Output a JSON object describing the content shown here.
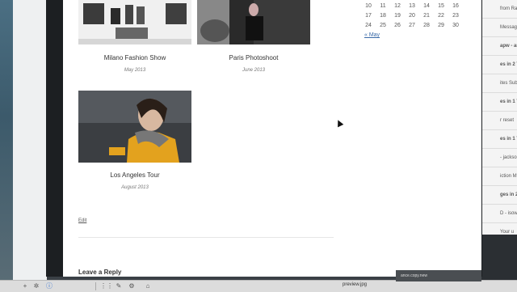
{
  "gallery": {
    "items": [
      {
        "caption": "Milano Fashion Show",
        "date": "May 2013"
      },
      {
        "caption": "Paris Photoshoot",
        "date": "June 2013"
      },
      {
        "caption": "Los Angeles Tour",
        "date": "August 2013"
      }
    ],
    "edit_label": "Edit",
    "reply_heading": "Leave a Reply"
  },
  "calendar": {
    "rows": [
      [
        "10",
        "11",
        "12",
        "13",
        "14",
        "15",
        "16"
      ],
      [
        "17",
        "18",
        "19",
        "20",
        "21",
        "22",
        "23"
      ],
      [
        "24",
        "25",
        "26",
        "27",
        "28",
        "29",
        "30"
      ]
    ],
    "prev_label": "« May"
  },
  "mail_list": [
    {
      "text": "from Radu"
    },
    {
      "text": "Messag"
    },
    {
      "text": "apw - an",
      "bold": true
    },
    {
      "text": "es in 2 T",
      "bold": true
    },
    {
      "text": "ites Sub"
    },
    {
      "text": "es in 1 T",
      "bold": true
    },
    {
      "text": "r reset"
    },
    {
      "text": "es in 1 T",
      "bold": true
    },
    {
      "text": "- jackso"
    },
    {
      "text": "iction M"
    },
    {
      "text": "ges in 2",
      "bold": true
    },
    {
      "text": "D - isowe"
    },
    {
      "text": "Your u"
    }
  ],
  "toolbar": {
    "filename": "preview.jpg",
    "status": "ance.copy.new"
  },
  "icons": [
    "plus-icon",
    "gear-icon",
    "info-icon",
    "grid-icon",
    "pencil-icon",
    "gear-icon",
    "tag-icon"
  ]
}
